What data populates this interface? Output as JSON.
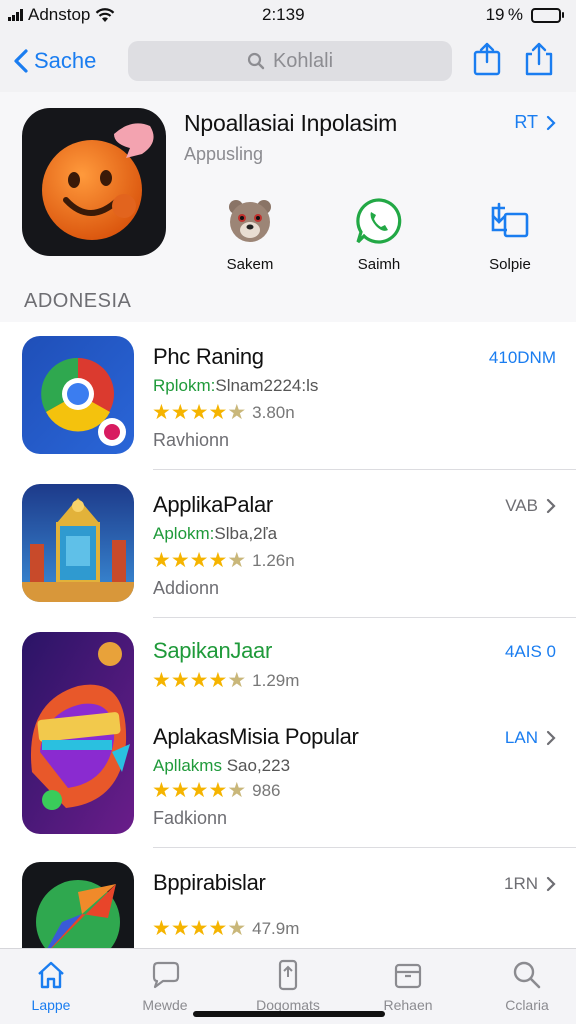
{
  "status_bar": {
    "carrier": "Adnstop",
    "time": "2:139",
    "battery": "19 %"
  },
  "nav": {
    "back_label": "Sache",
    "search_placeholder": "Kohlali"
  },
  "featured": {
    "title": "Npoallasiai Inpolasim",
    "subtitle": "Appusling",
    "action_label": "RT",
    "mini_apps": [
      {
        "label": "Sakem",
        "icon": "bear-app-icon"
      },
      {
        "label": "Saimh",
        "icon": "phone-chat-app-icon"
      },
      {
        "label": "Solpie",
        "icon": "share-app-icon"
      }
    ]
  },
  "section_title": "ADONESIA",
  "apps": [
    {
      "name": "Phc Raning",
      "category": "Rplokm:",
      "category_rest": "Slnam2224:ls",
      "rating": 4.5,
      "rating_count": "3.80n",
      "developer": "Ravhionn",
      "action": "410DNM",
      "icon": "browser-app-icon"
    },
    {
      "name": "ApplikaPalar",
      "category": "Aplokm:",
      "category_rest": "Slba,2ľa",
      "rating": 4.5,
      "rating_count": "1.26n",
      "developer": "Addionn",
      "action": "VAB",
      "icon": "palace-app-icon"
    },
    {
      "name": "SapikanJaar",
      "category": "",
      "category_rest": "",
      "rating": 4.5,
      "rating_count": "1.29m",
      "developer": "",
      "action": "4AIS 0",
      "icon": "game-app-icon"
    },
    {
      "name": "AplakasMisia Popular",
      "category": "Apllakms",
      "category_rest": "Sao,223",
      "rating": 4.5,
      "rating_count": "986",
      "developer": "Fadkionn",
      "action": "LAN",
      "icon": "game-app-icon"
    },
    {
      "name": "Bppirabislar",
      "category": "",
      "category_rest": "",
      "rating": 4.5,
      "rating_count": "47.9m",
      "developer": "",
      "action": "1RN",
      "icon": "arrow-app-icon"
    }
  ],
  "tabs": [
    {
      "label": "Lappe",
      "icon": "home-icon",
      "active": true
    },
    {
      "label": "Mewde",
      "icon": "chat-icon",
      "active": false
    },
    {
      "label": "Dogomats",
      "icon": "phone-icon",
      "active": false
    },
    {
      "label": "Rehaen",
      "icon": "box-icon",
      "active": false
    },
    {
      "label": "Cclaria",
      "icon": "search-icon",
      "active": false
    }
  ],
  "colors": {
    "accent": "#1a7df0",
    "green": "#1f9a3a",
    "star": "#f5b400"
  }
}
